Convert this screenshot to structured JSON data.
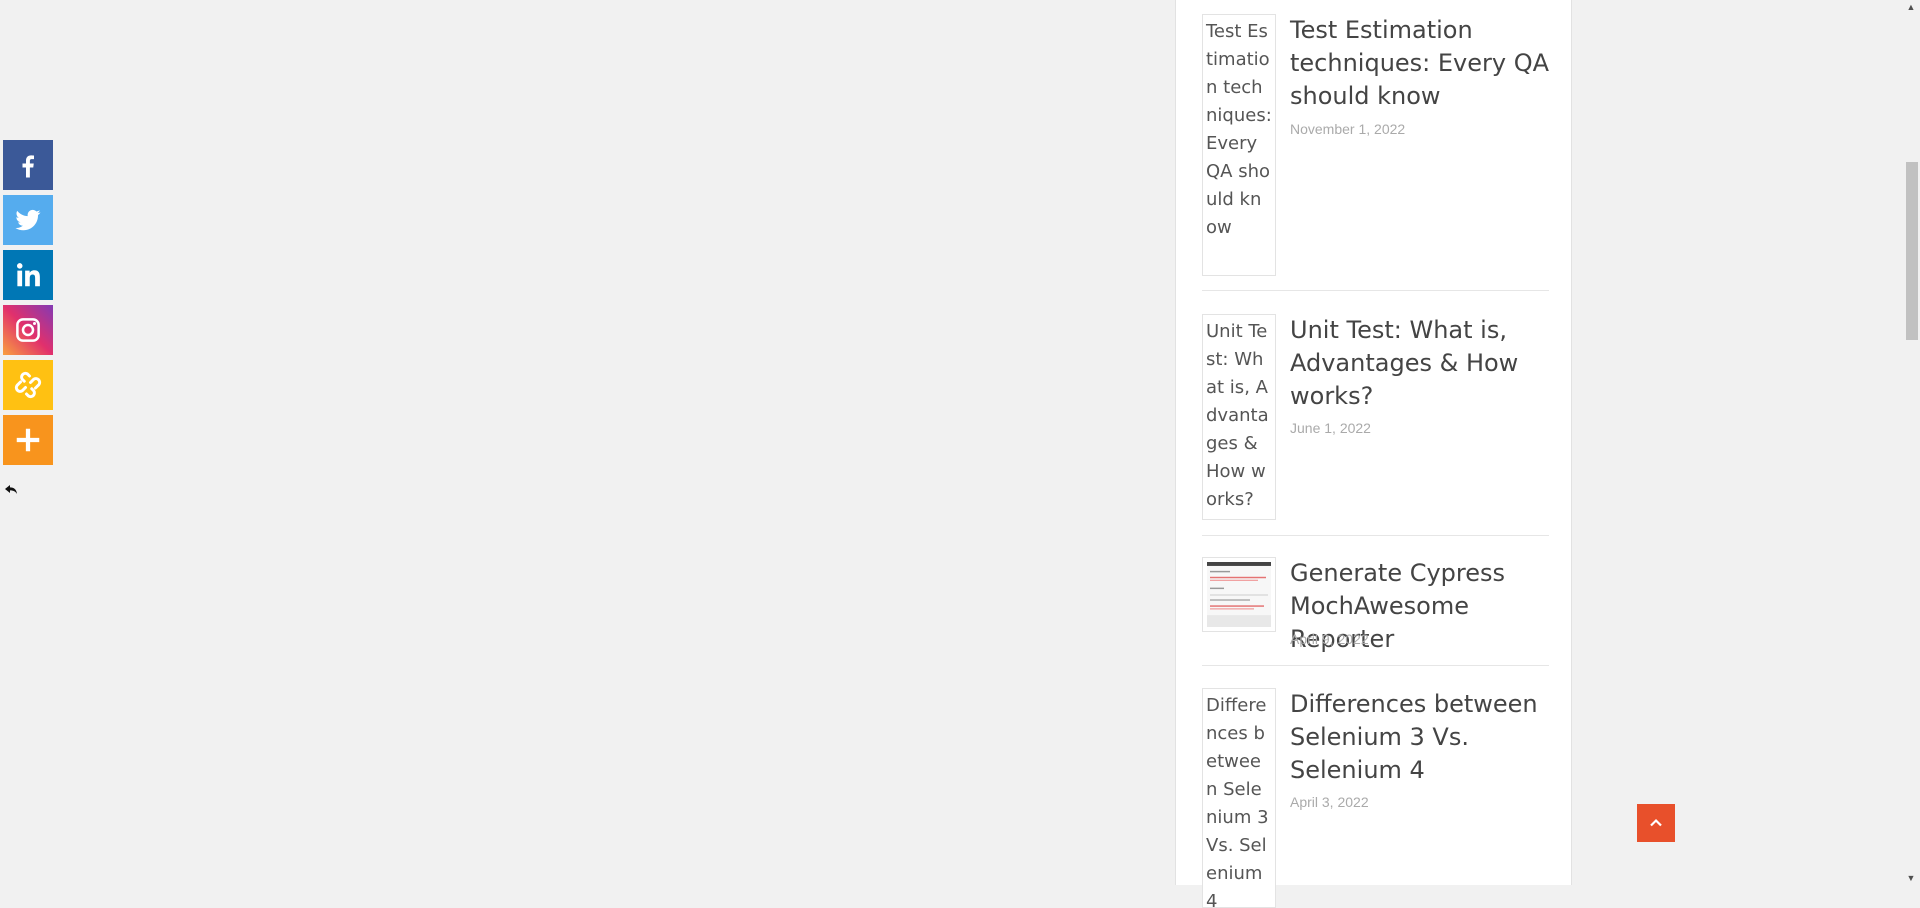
{
  "share": {
    "buttons": [
      {
        "network": "Facebook",
        "color": "#3b5998",
        "icon": "facebook-icon"
      },
      {
        "network": "Twitter",
        "color": "#55acee",
        "icon": "twitter-icon"
      },
      {
        "network": "Linkedin",
        "color": "#0077b5",
        "icon": "linkedin-icon"
      },
      {
        "network": "Instagram",
        "color": "#c13584",
        "icon": "instagram-icon"
      },
      {
        "network": "Copy Link",
        "color": "#ffc112",
        "icon": "link-icon"
      },
      {
        "network": "More",
        "color": "#f8941d",
        "icon": "plus-icon"
      }
    ]
  },
  "posts": [
    {
      "thumb_alt": "Test Estimation techniques: Every QA should know",
      "title": "Test Estimation techniques: Every QA should know",
      "date": "November 1, 2022"
    },
    {
      "thumb_alt": "Unit Test: What is, Advantages & How works?",
      "title": "Unit Test: What is, Advantages & How works?",
      "date": "June 1, 2022"
    },
    {
      "thumb_alt": "",
      "title": "Generate Cypress MochAwesome Reporter",
      "date": "April 9, 2022"
    },
    {
      "thumb_alt": "Differences between Selenium 3 Vs. Selenium 4",
      "title": "Differences between Selenium 3 Vs. Selenium 4",
      "date": "April 3, 2022"
    }
  ],
  "colors": {
    "accent": "#e8502b",
    "background": "#f1f1f1"
  }
}
